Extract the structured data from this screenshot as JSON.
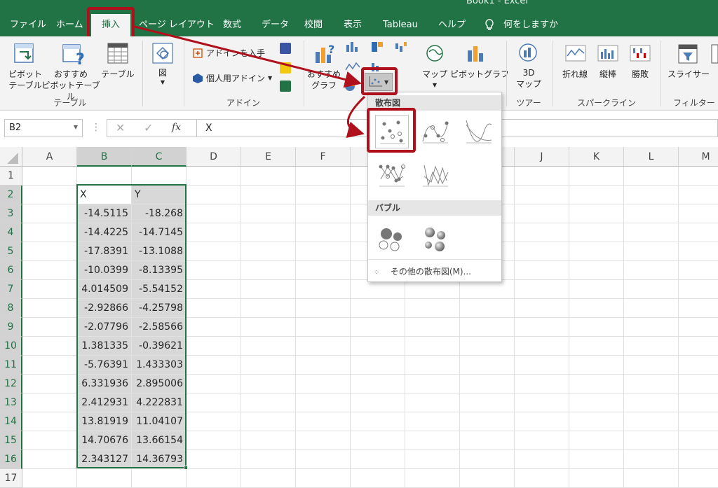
{
  "app": {
    "title": "Book1 - Excel"
  },
  "tabs": [
    "ファイル",
    "ホーム",
    "挿入",
    "ページ レイアウト",
    "数式",
    "データ",
    "校閲",
    "表示",
    "Tableau",
    "ヘルプ",
    "何をしますか"
  ],
  "ribbon": {
    "table_group": {
      "pivot_label": "ピボット\nテーブル",
      "recommended_pivot_label": "おすすめ\nピボットテーブル",
      "table_label": "テーブル",
      "group_name": "テーブル"
    },
    "illustrations": {
      "label": "図"
    },
    "addins": {
      "get_label": "アドインを入手",
      "my_label": "個人用アドイン",
      "group_name": "アドイン"
    },
    "charts": {
      "recommended_label": "おすすめ\nグラフ",
      "maps_label": "マップ",
      "pivot_chart_label": "ピボットグラフ"
    },
    "tours": {
      "label": "3D\nマップ",
      "group_name": "ツアー"
    },
    "sparklines": {
      "line_label": "折れ線",
      "column_label": "縦棒",
      "winloss_label": "勝敗",
      "group_name": "スパークライン"
    },
    "filters": {
      "slicer_label": "スライサー",
      "group_name": "フィルター"
    }
  },
  "formula_bar": {
    "name_box": "B2",
    "fx": "fx",
    "value": "X"
  },
  "columns": [
    "A",
    "B",
    "C",
    "D",
    "E",
    "F",
    "G",
    "H",
    "I",
    "J",
    "K",
    "L",
    "M"
  ],
  "rows": [
    {
      "n": "1",
      "x": "",
      "y": ""
    },
    {
      "n": "2",
      "x": "X",
      "y": "Y"
    },
    {
      "n": "3",
      "x": "-14.5115",
      "y": "-18.268"
    },
    {
      "n": "4",
      "x": "-14.4225",
      "y": "-14.7145"
    },
    {
      "n": "5",
      "x": "-17.8391",
      "y": "-13.1088"
    },
    {
      "n": "6",
      "x": "-10.0399",
      "y": "-8.13395"
    },
    {
      "n": "7",
      "x": "4.014509",
      "y": "-5.54152"
    },
    {
      "n": "8",
      "x": "-2.92866",
      "y": "-4.25798"
    },
    {
      "n": "9",
      "x": "-2.07796",
      "y": "-2.58566"
    },
    {
      "n": "10",
      "x": "1.381335",
      "y": "-0.39621"
    },
    {
      "n": "11",
      "x": "-5.76391",
      "y": "1.433303"
    },
    {
      "n": "12",
      "x": "6.331936",
      "y": "2.895006"
    },
    {
      "n": "13",
      "x": "2.412931",
      "y": "4.222831"
    },
    {
      "n": "14",
      "x": "13.81919",
      "y": "11.04107"
    },
    {
      "n": "15",
      "x": "14.70676",
      "y": "13.66154"
    },
    {
      "n": "16",
      "x": "2.343127",
      "y": "14.36793"
    },
    {
      "n": "17",
      "x": "",
      "y": ""
    }
  ],
  "dropdown": {
    "scatter_header": "散布図",
    "bubble_header": "バブル",
    "more_label": "その他の散布図(M)..."
  },
  "colors": {
    "excel_green": "#217346",
    "highlight_red": "#b0101b"
  }
}
